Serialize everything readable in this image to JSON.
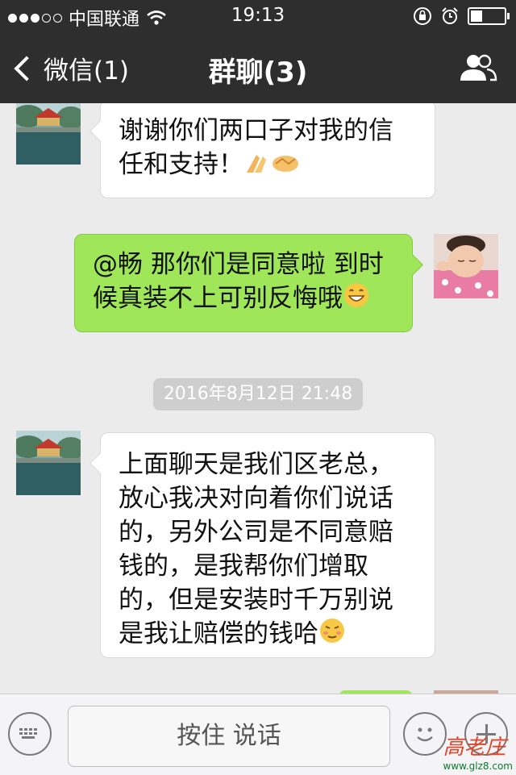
{
  "status_bar": {
    "carrier": "中国联通",
    "time": "19:13"
  },
  "nav": {
    "back_label": "微信(1)",
    "title": "群聊(3)"
  },
  "messages": [
    {
      "side": "left",
      "text": "谢谢你们两口子对我的信任和支持！"
    },
    {
      "side": "right",
      "text": "@畅 那你们是同意啦 到时候真装不上可别反悔哦"
    },
    {
      "side": "left",
      "text": "上面聊天是我们区老总，放心我决对向着你们说话的，另外公司是不同意赔钱的，是我帮你们增取的，但是安装时千万别说是我让赔偿的钱哈"
    }
  ],
  "timestamp": "2016年8月12日 21:48",
  "input_bar": {
    "hold_to_talk": "按住 说话"
  },
  "watermark": {
    "text": "www.glz8.com"
  },
  "colors": {
    "nav_bg": "#2e2e2e",
    "chat_bg": "#ebebeb",
    "outgoing_bubble": "#9fe658",
    "incoming_bubble": "#ffffff"
  },
  "icons": {
    "back": "chevron-left-icon",
    "group": "group-members-icon",
    "keyboard": "keyboard-icon",
    "emoji": "emoji-icon",
    "plus": "plus-icon"
  }
}
